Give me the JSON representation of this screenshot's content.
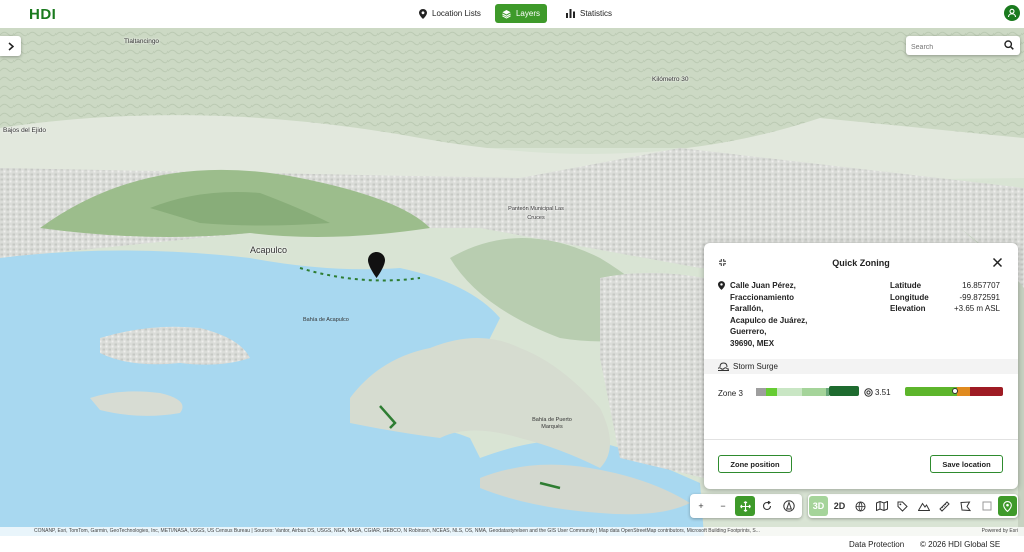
{
  "app": {
    "logo": "HDI"
  },
  "nav": {
    "items": [
      {
        "label": "Location Lists",
        "icon": "location-pin-icon",
        "active": false
      },
      {
        "label": "Layers",
        "icon": "layers-icon",
        "active": true
      },
      {
        "label": "Statistics",
        "icon": "bar-chart-icon",
        "active": false
      }
    ]
  },
  "search": {
    "placeholder": "Search"
  },
  "map": {
    "labels": {
      "tlaltancingo": "Tlaltancingo",
      "kilometro30": "Kilómetro 30",
      "bajos": "Bajos del Ejido",
      "panteon": "Panteón Municipal Las Cruces",
      "acapulco": "Acapulco",
      "bahia_acapulco": "Bahía de Acapulco",
      "bahia_puerto": "Bahía de Puerto Marqués"
    },
    "attribution": "CONANP, Esri, TomTom, Garmin, GeoTechnologies, Inc, METI/NASA, USGS, US Census Bureau | Sources: Vantor, Airbus DS, USGS, NGA, NASA, CGIAR, GEBCO, N Robinson, NCEAS, NLS, OS, NMA, Geodatastyrelsen and the GIS User Community | Map data OpenStreetMap contributors, Microsoft Building Footprints, S...",
    "powered_by": "Powered by Esri"
  },
  "panel": {
    "title": "Quick Zoning",
    "address": [
      "Calle Juan Pérez,",
      "Fraccionamiento",
      "Farallón,",
      "Acapulco de Juárez,",
      "Guerrero,",
      "39690, MEX"
    ],
    "latitude_label": "Latitude",
    "latitude": "16.857707",
    "longitude_label": "Longitude",
    "longitude": "-99.872591",
    "elevation_label": "Elevation",
    "elevation": "+3.65 m ASL",
    "section": "Storm Surge",
    "zone_label": "Zone 3",
    "zone_level": 3,
    "score": "3.51",
    "zone_colors": [
      "#9e9e9e",
      "#66cc33",
      "#c9e6c4",
      "#a5d49a",
      "#6aa87a",
      "#1e6b2f"
    ],
    "risk_colors": [
      "#5db52b",
      "#e08a1f",
      "#9e1b23"
    ],
    "zone_position_label": "Zone position",
    "save_location_label": "Save location"
  },
  "toolbar": {
    "zoom_in": "+",
    "zoom_out": "−",
    "view3d": "3D",
    "view2d": "2D"
  },
  "footer": {
    "data_protection": "Data Protection",
    "copyright": "© 2026 HDI Global SE"
  }
}
